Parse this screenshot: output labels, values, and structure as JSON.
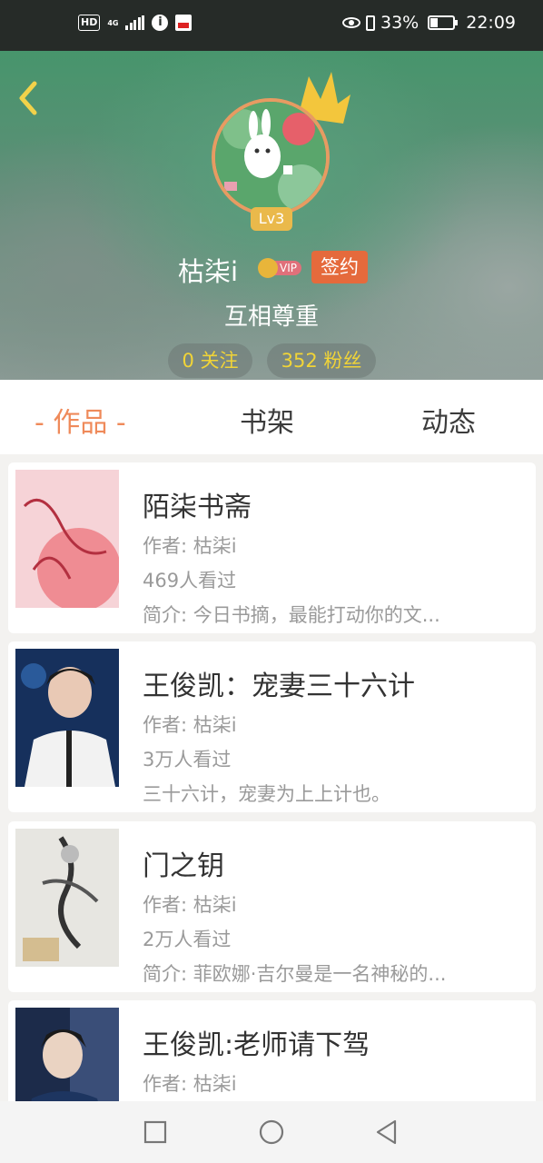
{
  "status_bar": {
    "hd": "HD",
    "network": "4G",
    "battery": "33%",
    "time": "22:09"
  },
  "profile": {
    "username": "枯柒i",
    "level": "Lv3",
    "vip": "VIP",
    "sign": "签约",
    "motto": "互相尊重",
    "following": "0 关注",
    "fans": "352 粉丝"
  },
  "tabs": [
    {
      "label": "- 作品 -",
      "active": true
    },
    {
      "label": "书架",
      "active": false
    },
    {
      "label": "动态",
      "active": false
    }
  ],
  "books": [
    {
      "title": "陌柒书斋",
      "author": "作者: 枯柒i",
      "views": "469人看过",
      "intro": "简介: 今日书摘，最能打动你的文..."
    },
    {
      "title": "王俊凯：宠妻三十六计",
      "author": "作者: 枯柒i",
      "views": "3万人看过",
      "intro": "三十六计，宠妻为上上计也。"
    },
    {
      "title": "门之钥",
      "author": "作者: 枯柒i",
      "views": "2万人看过",
      "intro": "简介: 菲欧娜·吉尔曼是一名神秘的..."
    },
    {
      "title": "王俊凯:老师请下驾",
      "author": "作者: 枯柒i",
      "views": "",
      "intro": ""
    }
  ],
  "colors": {
    "accent": "#ef8a5a",
    "sign_badge": "#e56a3c",
    "level_badge": "#eab94b",
    "fans_text": "#f1d437"
  }
}
